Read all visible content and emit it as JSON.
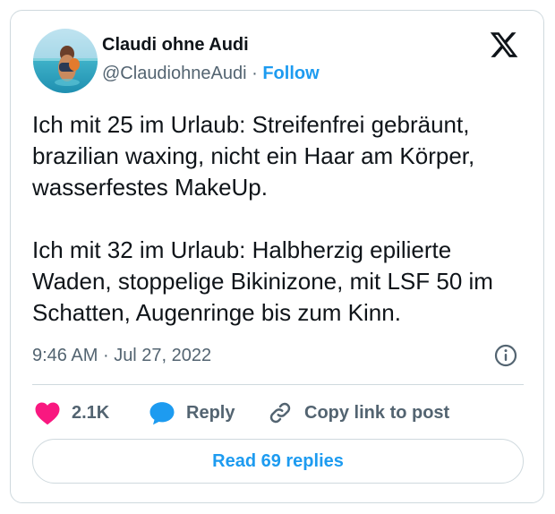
{
  "author": {
    "display_name": "Claudi ohne Audi",
    "handle": "@ClaudiohneAudi",
    "separator": "·",
    "follow_label": "Follow"
  },
  "tweet": {
    "text": "Ich mit 25 im Urlaub: Streifenfrei gebräunt, brazilian waxing, nicht ein Haar am Körper, wasserfestes MakeUp.\n\nIch mit 32 im Urlaub: Halbherzig epilierte Waden, stoppelige Bikinizone, mit LSF 50 im Schatten, Augenringe bis zum Kinn.",
    "time": "9:46 AM",
    "meta_separator": "·",
    "date": "Jul 27, 2022"
  },
  "actions": {
    "like_count": "2.1K",
    "reply_label": "Reply",
    "copy_link_label": "Copy link to post",
    "read_replies_label": "Read 69 replies"
  },
  "icons": {
    "brand": "x-logo-icon",
    "info": "info-icon",
    "like": "heart-icon",
    "reply": "speech-bubble-icon",
    "copy": "link-icon"
  },
  "colors": {
    "accent": "#1d9bf0",
    "like": "#f91880",
    "text_primary": "#0f1419",
    "text_secondary": "#536471",
    "border": "#cfd9de"
  }
}
